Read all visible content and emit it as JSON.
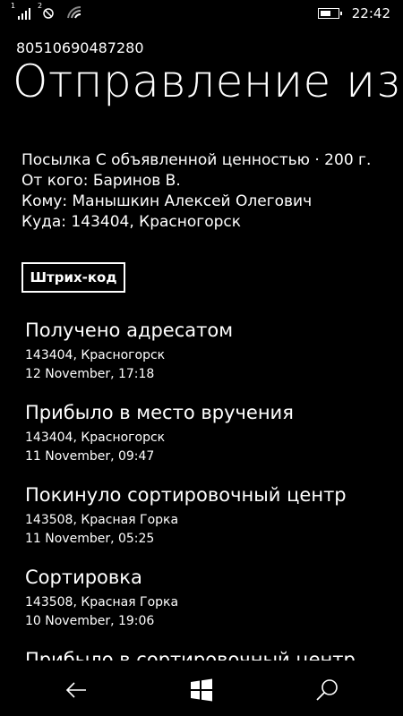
{
  "statusbar": {
    "sim1_label": "1",
    "sim2_label": "2",
    "time": "22:42",
    "battery_level": 0.6
  },
  "header": {
    "tracking_number": "80510690487280",
    "title": "Отправление из В"
  },
  "details": {
    "parcel_type": "Посылка С объявленной ценностью · 200 г.",
    "from": "От кого: Баринов В.",
    "to": "Кому: Манышкин Алексей Олегович",
    "destination": "Куда: 143404, Красногорск"
  },
  "barcode_button": {
    "label": "Штрих-код"
  },
  "events": [
    {
      "status": "Получено адресатом",
      "place": "143404, Красногорск",
      "date": "12 November, 17:18"
    },
    {
      "status": "Прибыло в место вручения",
      "place": "143404, Красногорск",
      "date": "11 November, 09:47"
    },
    {
      "status": "Покинуло сортировочный центр",
      "place": "143508, Красная Горка",
      "date": "11 November, 05:25"
    },
    {
      "status": "Сортировка",
      "place": "143508, Красная Горка",
      "date": "10 November, 19:06"
    },
    {
      "status": "Прибыло в сортировочный центр",
      "place": "",
      "date": ""
    }
  ],
  "navbar": {
    "back_icon": "back-arrow-icon",
    "home_icon": "windows-logo-icon",
    "search_icon": "search-icon"
  }
}
